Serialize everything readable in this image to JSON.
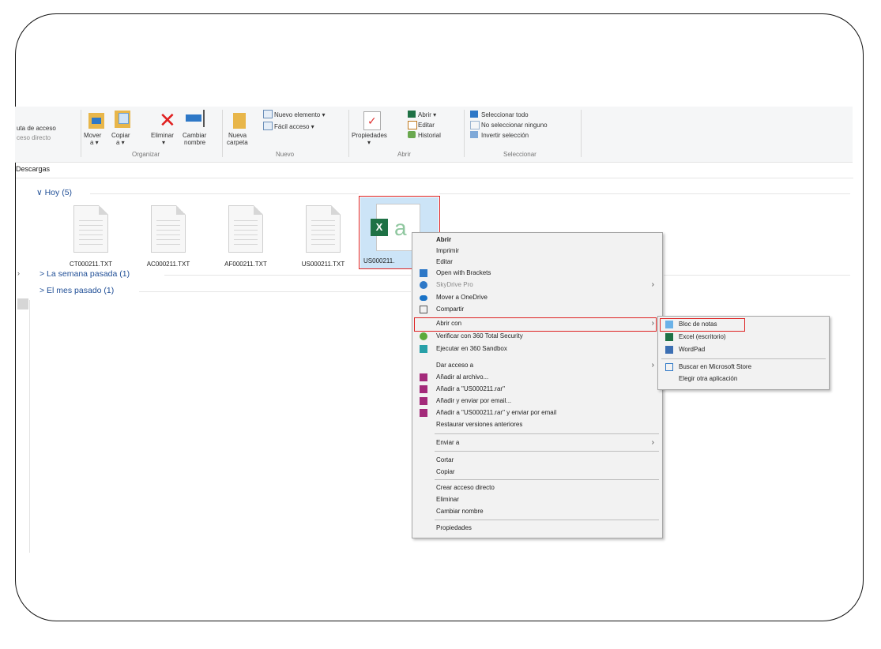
{
  "ribbon": {
    "left_cut_1": "uta de acceso",
    "left_cut_2": "ceso directo",
    "mover": "Mover",
    "mover_sub": "a ▾",
    "copiar": "Copiar",
    "copiar_sub": "a ▾",
    "eliminar": "Eliminar",
    "eliminar_sub": "▾",
    "cambiar": "Cambiar",
    "cambiar_sub": "nombre",
    "nueva": "Nueva",
    "nueva_sub": "carpeta",
    "nuevo_elemento": "Nuevo elemento ▾",
    "facil_acceso": "Fácil acceso ▾",
    "propiedades": "Propiedades",
    "propiedades_sub": "▾",
    "abrir": "Abrir ▾",
    "editar": "Editar",
    "historial": "Historial",
    "sel_todo": "Seleccionar todo",
    "no_sel": "No seleccionar ninguno",
    "invertir": "Invertir selección",
    "groups": {
      "organizar": "Organizar",
      "nuevo": "Nuevo",
      "abrir": "Abrir",
      "seleccionar": "Seleccionar"
    }
  },
  "breadcrumb": "Descargas",
  "groups": {
    "hoy": "∨  Hoy (5)",
    "semana": ">  La semana pasada (1)",
    "mes": ">  El mes pasado (1)"
  },
  "files": [
    {
      "name": "CT000211.TXT"
    },
    {
      "name": "AC000211.TXT"
    },
    {
      "name": "AF000211.TXT"
    },
    {
      "name": "US000211.TXT"
    },
    {
      "name": "US000211."
    }
  ],
  "context_menu": {
    "items": [
      "Abrir",
      "Imprimir",
      "Editar",
      "Open with Brackets",
      "SkyDrive Pro",
      "Mover a OneDrive",
      "Compartir",
      "Abrir con",
      "Verificar con 360 Total Security",
      "Ejecutar en 360 Sandbox",
      "Dar acceso a",
      "Añadir al archivo...",
      "Añadir a \"US000211.rar\"",
      "Añadir y enviar por email...",
      "Añadir a \"US000211.rar\" y enviar por email",
      "Restaurar versiones anteriores",
      "Enviar a",
      "Cortar",
      "Copiar",
      "Crear acceso directo",
      "Eliminar",
      "Cambiar nombre",
      "Propiedades"
    ]
  },
  "submenu": {
    "items": [
      "Bloc de notas",
      "Excel (escritorio)",
      "WordPad",
      "Buscar en Microsoft Store",
      "Elegir otra aplicación"
    ]
  },
  "colors": {
    "highlight_border": "#d22222",
    "excel_green": "#1e7145",
    "link_blue": "#1f4e96"
  }
}
